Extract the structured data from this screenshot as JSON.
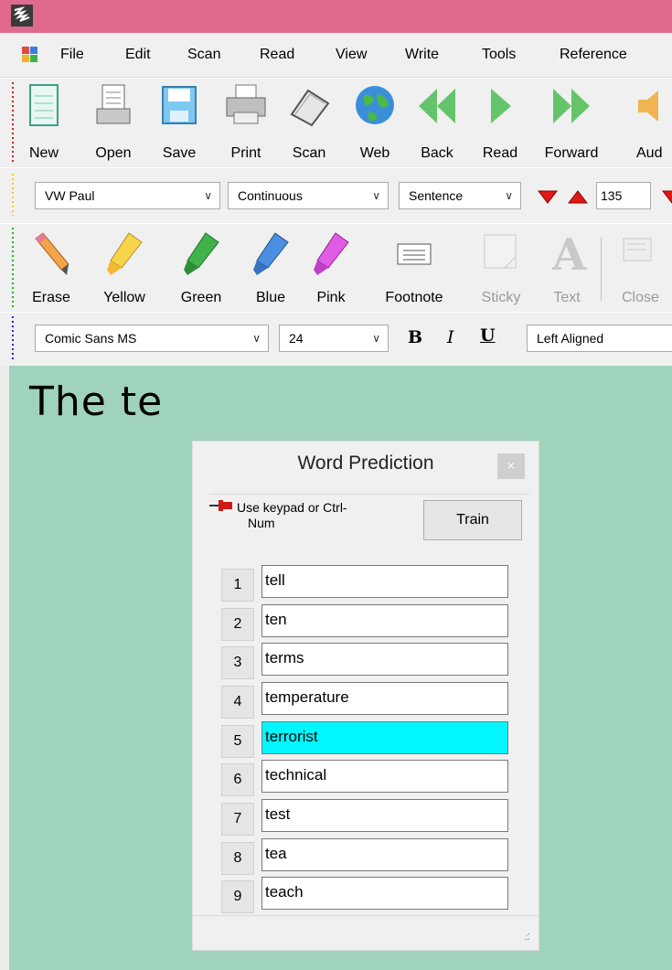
{
  "menu": [
    "File",
    "Edit",
    "Scan",
    "Read",
    "View",
    "Write",
    "Tools",
    "Reference"
  ],
  "main_toolbar": {
    "buttons": [
      {
        "label": "New",
        "icon": "new-document-icon"
      },
      {
        "label": "Open",
        "icon": "open-document-icon"
      },
      {
        "label": "Save",
        "icon": "floppy-disk-icon"
      },
      {
        "label": "Print",
        "icon": "printer-icon"
      },
      {
        "label": "Scan",
        "icon": "scanner-icon"
      },
      {
        "label": "Web",
        "icon": "globe-icon"
      },
      {
        "label": "Back",
        "icon": "rewind-icon"
      },
      {
        "label": "Read",
        "icon": "play-icon"
      },
      {
        "label": "Forward",
        "icon": "fast-forward-icon"
      },
      {
        "label": "Aud",
        "icon": "speaker-icon"
      }
    ]
  },
  "reading_toolbar": {
    "voice": "VW Paul",
    "mode": "Continuous",
    "unit": "Sentence",
    "speed": "135"
  },
  "highlight_toolbar": {
    "buttons": [
      {
        "label": "Erase",
        "icon": "eraser-icon"
      },
      {
        "label": "Yellow",
        "icon": "yellow-highlighter-icon",
        "color": "#f8d44a"
      },
      {
        "label": "Green",
        "icon": "green-highlighter-icon",
        "color": "#3fb34a"
      },
      {
        "label": "Blue",
        "icon": "blue-highlighter-icon",
        "color": "#4a8fe0"
      },
      {
        "label": "Pink",
        "icon": "pink-highlighter-icon",
        "color": "#e05ce6"
      },
      {
        "label": "Footnote",
        "icon": "footnote-icon"
      },
      {
        "label": "Sticky",
        "icon": "sticky-note-icon",
        "disabled": true
      },
      {
        "label": "Text",
        "icon": "text-note-icon",
        "disabled": true
      },
      {
        "label": "Close",
        "icon": "close-note-icon",
        "disabled": true
      }
    ]
  },
  "format_toolbar": {
    "font": "Comic Sans MS",
    "size": "24",
    "bold": "B",
    "italic": "I",
    "underline": "U",
    "alignment": "Left Aligned"
  },
  "document": {
    "text": "The te"
  },
  "word_prediction": {
    "title": "Word Prediction",
    "close": "×",
    "hint": "Use keypad or Ctrl-Num",
    "hint_line1": "Use keypad or Ctrl-",
    "hint_line2": "Num",
    "train_label": "Train",
    "words": [
      {
        "num": "1",
        "word": "tell"
      },
      {
        "num": "2",
        "word": "ten"
      },
      {
        "num": "3",
        "word": "terms"
      },
      {
        "num": "4",
        "word": "temperature"
      },
      {
        "num": "5",
        "word": "terrorist",
        "selected": true
      },
      {
        "num": "6",
        "word": "technical"
      },
      {
        "num": "7",
        "word": "test"
      },
      {
        "num": "8",
        "word": "tea"
      },
      {
        "num": "9",
        "word": "teach"
      }
    ]
  },
  "colors": {
    "title_bar": "#e06a8e",
    "document_bg": "#9fd3bb",
    "selected_word": "#00f7ff"
  }
}
